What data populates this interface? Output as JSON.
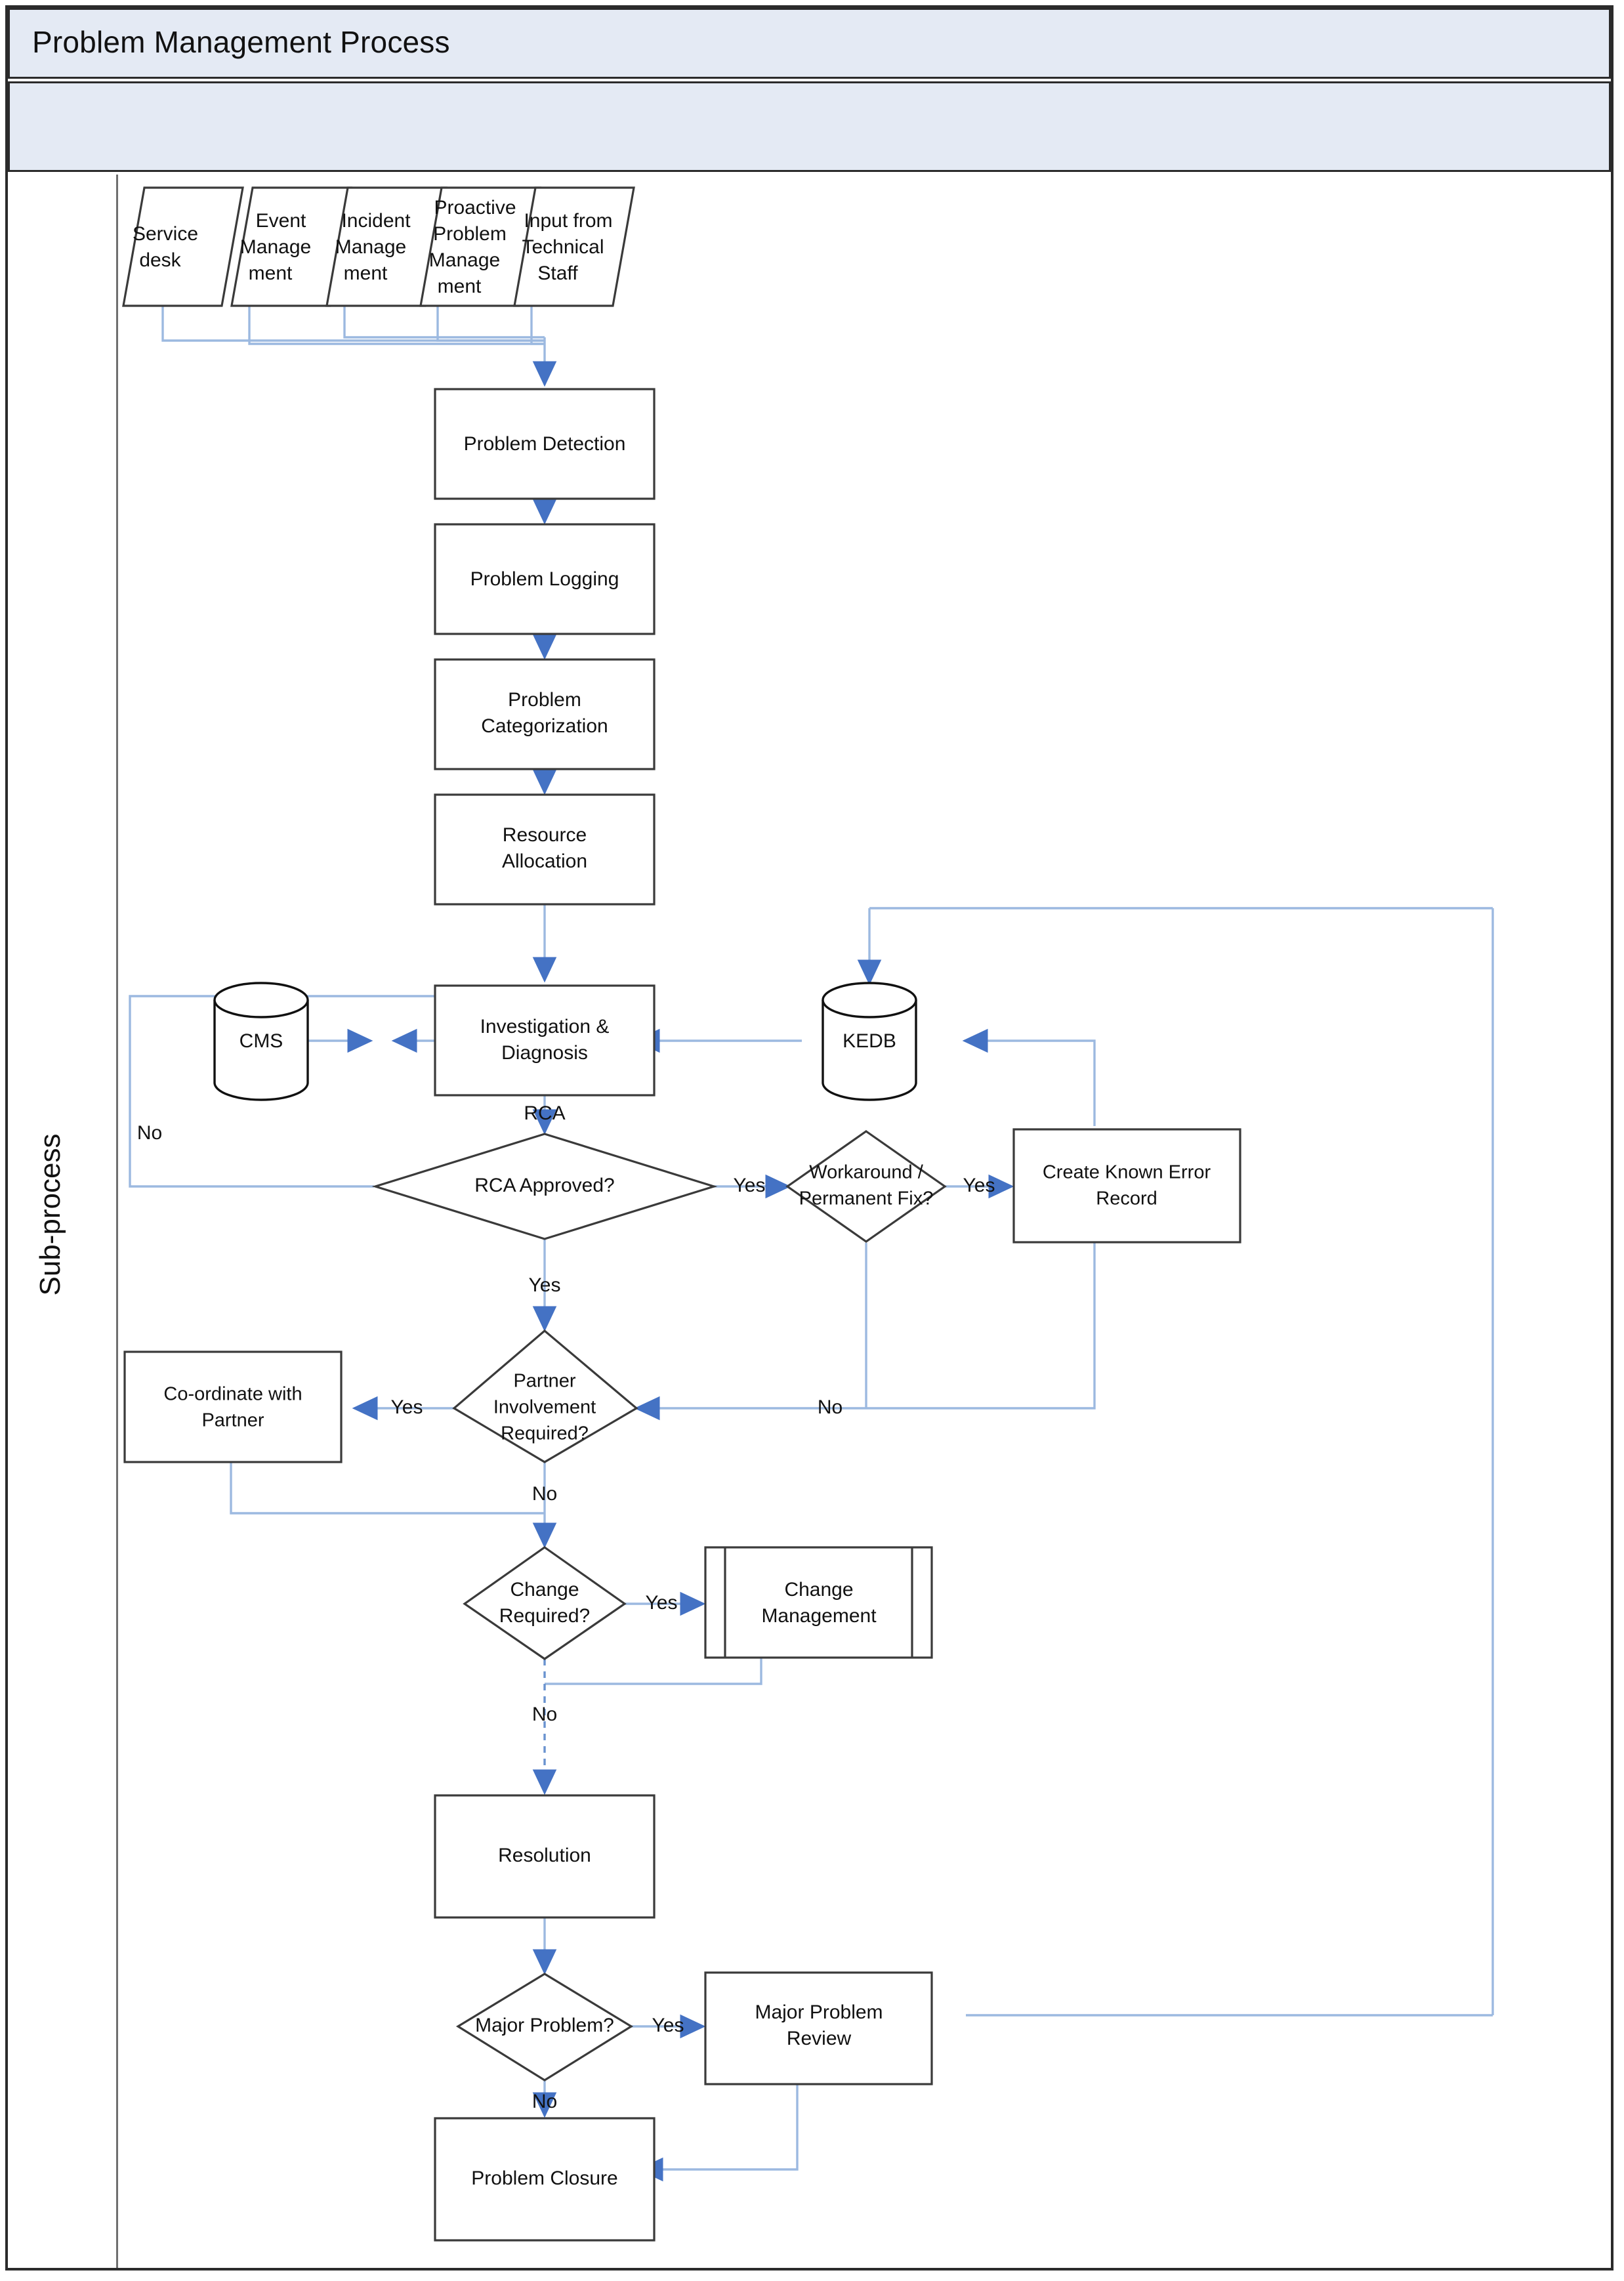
{
  "header": {
    "title": "Problem Management Process",
    "subtitle": ""
  },
  "lane": {
    "label": "Sub-process"
  },
  "colors": {
    "header_fill": "#E4EAF4",
    "frame_border": "#2B2B2B",
    "connector_line": "#9CB9E0",
    "arrow_head": "#4472C4",
    "shape_border": "#3A3A3A",
    "shape_fill": "#FFFFFF"
  },
  "chart_data": {
    "type": "diagram",
    "title": "Problem Management Process",
    "diagram_kind": "flowchart",
    "nodes": [
      {
        "id": "n1",
        "label": "Service desk",
        "shape": "parallelogram"
      },
      {
        "id": "n2",
        "label": "Event Manage ment",
        "shape": "parallelogram"
      },
      {
        "id": "n3",
        "label": "Incident Manage ment",
        "shape": "parallelogram"
      },
      {
        "id": "n4",
        "label": "Proactive Problem Manage ment",
        "shape": "parallelogram"
      },
      {
        "id": "n5",
        "label": "Input from Technical Staff",
        "shape": "parallelogram"
      },
      {
        "id": "n6",
        "label": "Problem Detection",
        "shape": "process"
      },
      {
        "id": "n7",
        "label": "Problem Logging",
        "shape": "process"
      },
      {
        "id": "n8",
        "label": "Problem Categorization",
        "shape": "process"
      },
      {
        "id": "n9",
        "label": "Resource Allocation",
        "shape": "process"
      },
      {
        "id": "n10",
        "label": "Investigation & Diagnosis",
        "shape": "process"
      },
      {
        "id": "n11",
        "label": "CMS",
        "shape": "database"
      },
      {
        "id": "n12",
        "label": "KEDB",
        "shape": "database"
      },
      {
        "id": "n13",
        "label": "RCA Approved?",
        "shape": "decision"
      },
      {
        "id": "n14",
        "label": "Workaround / Permanent Fix?",
        "shape": "decision"
      },
      {
        "id": "n15",
        "label": "Create Known Error Record",
        "shape": "process"
      },
      {
        "id": "n16",
        "label": "Partner Involvement Required?",
        "shape": "decision"
      },
      {
        "id": "n17",
        "label": "Co-ordinate with Partner",
        "shape": "process"
      },
      {
        "id": "n18",
        "label": "Change Required?",
        "shape": "decision"
      },
      {
        "id": "n19",
        "label": "Change Management",
        "shape": "predefined-process"
      },
      {
        "id": "n20",
        "label": "Resolution",
        "shape": "process"
      },
      {
        "id": "n21",
        "label": "Major Problem?",
        "shape": "decision"
      },
      {
        "id": "n22",
        "label": "Major Problem Review",
        "shape": "process"
      },
      {
        "id": "n23",
        "label": "Problem Closure",
        "shape": "process"
      }
    ],
    "edges": [
      {
        "from": "n1",
        "to": "n6",
        "label": ""
      },
      {
        "from": "n2",
        "to": "n6",
        "label": ""
      },
      {
        "from": "n3",
        "to": "n6",
        "label": ""
      },
      {
        "from": "n4",
        "to": "n6",
        "label": ""
      },
      {
        "from": "n5",
        "to": "n6",
        "label": ""
      },
      {
        "from": "n6",
        "to": "n7",
        "label": ""
      },
      {
        "from": "n7",
        "to": "n8",
        "label": ""
      },
      {
        "from": "n8",
        "to": "n9",
        "label": ""
      },
      {
        "from": "n9",
        "to": "n10",
        "label": ""
      },
      {
        "from": "n10",
        "to": "n11",
        "label": ""
      },
      {
        "from": "n11",
        "to": "n10",
        "label": ""
      },
      {
        "from": "n12",
        "to": "n10",
        "label": ""
      },
      {
        "from": "n10",
        "to": "n13",
        "label": "RCA"
      },
      {
        "from": "n13",
        "to": "n10",
        "label": "No"
      },
      {
        "from": "n13",
        "to": "n14",
        "label": "Yes"
      },
      {
        "from": "n13",
        "to": "n16",
        "label": "Yes"
      },
      {
        "from": "n14",
        "to": "n15",
        "label": "Yes"
      },
      {
        "from": "n14",
        "to": "n16",
        "label": "No"
      },
      {
        "from": "n15",
        "to": "n12",
        "label": ""
      },
      {
        "from": "n16",
        "to": "n17",
        "label": "Yes"
      },
      {
        "from": "n16",
        "to": "n18",
        "label": "No"
      },
      {
        "from": "n17",
        "to": "n18",
        "label": ""
      },
      {
        "from": "n18",
        "to": "n19",
        "label": "Yes"
      },
      {
        "from": "n18",
        "to": "n20",
        "label": "No"
      },
      {
        "from": "n19",
        "to": "n20",
        "label": ""
      },
      {
        "from": "n20",
        "to": "n12",
        "label": ""
      },
      {
        "from": "n20",
        "to": "n21",
        "label": ""
      },
      {
        "from": "n21",
        "to": "n22",
        "label": "Yes"
      },
      {
        "from": "n21",
        "to": "n23",
        "label": "No"
      },
      {
        "from": "n22",
        "to": "n23",
        "label": ""
      }
    ],
    "edge_labels": [
      "RCA",
      "No",
      "Yes",
      "Yes",
      "Yes",
      "Yes",
      "No",
      "Yes",
      "No",
      "Yes",
      "No",
      "Yes",
      "No"
    ]
  },
  "nodes": {
    "n1": {
      "l1": "Service",
      "l2": "desk",
      "l3": "",
      "l4": ""
    },
    "n2": {
      "l1": "Event",
      "l2": "Manage",
      "l3": "ment",
      "l4": ""
    },
    "n3": {
      "l1": "Incident",
      "l2": "Manage",
      "l3": "ment",
      "l4": ""
    },
    "n4": {
      "l1": "Proactive",
      "l2": "Problem",
      "l3": "Manage",
      "l4": "ment"
    },
    "n5": {
      "l1": "Input from",
      "l2": "Technical",
      "l3": "Staff",
      "l4": ""
    },
    "n6": {
      "l1": "Problem Detection",
      "l2": "",
      "l3": "",
      "l4": ""
    },
    "n7": {
      "l1": "Problem Logging",
      "l2": "",
      "l3": "",
      "l4": ""
    },
    "n8": {
      "l1": "Problem",
      "l2": "Categorization",
      "l3": "",
      "l4": ""
    },
    "n9": {
      "l1": "Resource",
      "l2": "Allocation",
      "l3": "",
      "l4": ""
    },
    "n10": {
      "l1": "Investigation &",
      "l2": "Diagnosis",
      "l3": "",
      "l4": ""
    },
    "n11": {
      "l1": "CMS",
      "l2": "",
      "l3": "",
      "l4": ""
    },
    "n12": {
      "l1": "KEDB",
      "l2": "",
      "l3": "",
      "l4": ""
    },
    "n13": {
      "l1": "RCA Approved?",
      "l2": "",
      "l3": "",
      "l4": ""
    },
    "n14": {
      "l1": "Workaround /",
      "l2": "Permanent Fix?",
      "l3": "",
      "l4": ""
    },
    "n15": {
      "l1": "Create Known Error",
      "l2": "Record",
      "l3": "",
      "l4": ""
    },
    "n16": {
      "l1": "Partner",
      "l2": "Involvement",
      "l3": "Required?",
      "l4": ""
    },
    "n17": {
      "l1": "Co-ordinate with",
      "l2": "Partner",
      "l3": "",
      "l4": ""
    },
    "n18": {
      "l1": "Change",
      "l2": "Required?",
      "l3": "",
      "l4": ""
    },
    "n19": {
      "l1": "Change",
      "l2": "Management",
      "l3": "",
      "l4": ""
    },
    "n20": {
      "l1": "Resolution",
      "l2": "",
      "l3": "",
      "l4": ""
    },
    "n21": {
      "l1": "Major Problem?",
      "l2": "",
      "l3": "",
      "l4": ""
    },
    "n22": {
      "l1": "Major Problem",
      "l2": "Review",
      "l3": "",
      "l4": ""
    },
    "n23": {
      "l1": "Problem Closure",
      "l2": "",
      "l3": "",
      "l4": ""
    }
  },
  "labels": {
    "rca": "RCA",
    "no_rca": "No",
    "yes_rca_right": "Yes",
    "yes_rca_down": "Yes",
    "yes_wa": "Yes",
    "no_wa": "No",
    "yes_partner": "Yes",
    "no_partner": "No",
    "yes_change": "Yes",
    "no_change": "No",
    "yes_major": "Yes",
    "no_major": "No"
  }
}
